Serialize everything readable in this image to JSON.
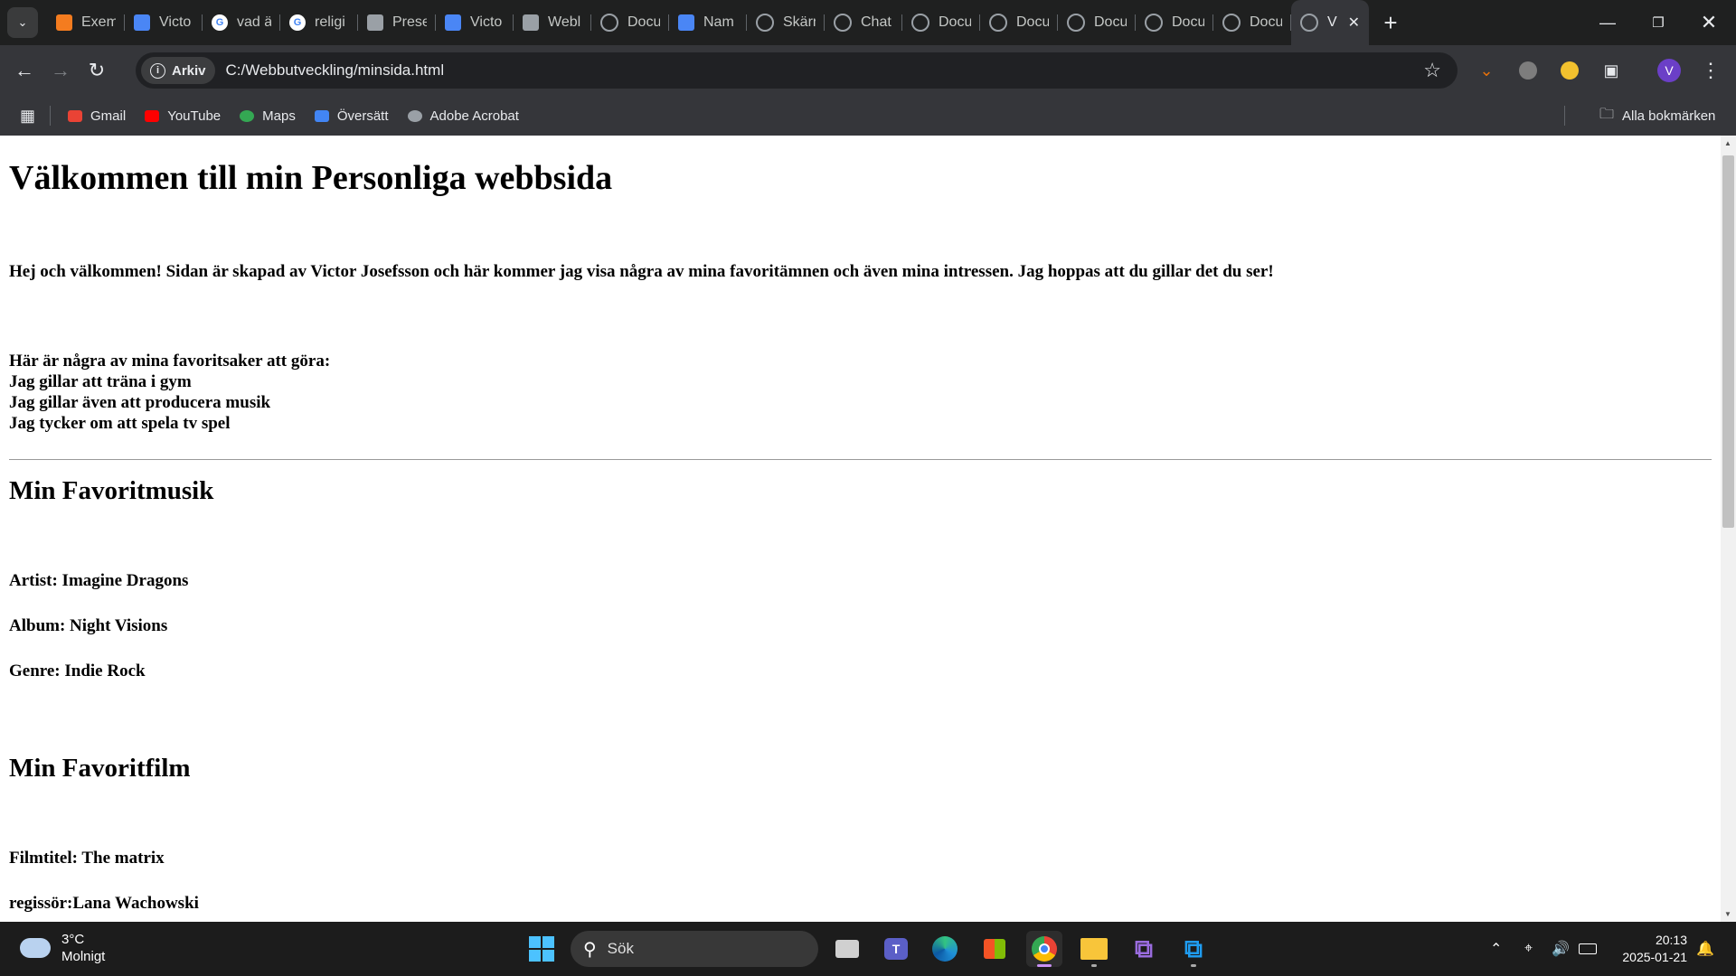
{
  "tabs": [
    {
      "title": "Exem",
      "icon": "presentation-icon",
      "color": "#f47c1f"
    },
    {
      "title": "Victo",
      "icon": "docs-icon",
      "color": "#4a86f5"
    },
    {
      "title": "vad ä",
      "icon": "google-icon",
      "color": "#ffffff"
    },
    {
      "title": "religi",
      "icon": "google-icon",
      "color": "#ffffff"
    },
    {
      "title": "Prese",
      "icon": "slides-icon",
      "color": "#9aa0a6"
    },
    {
      "title": "Victo",
      "icon": "docs-icon",
      "color": "#4a86f5"
    },
    {
      "title": "Webl",
      "icon": "slides-icon",
      "color": "#9aa0a6"
    },
    {
      "title": "Docu",
      "icon": "globe-icon",
      "color": "#9aa0a6"
    },
    {
      "title": "Nam",
      "icon": "docs-icon",
      "color": "#4a86f5"
    },
    {
      "title": "Skärn",
      "icon": "globe-icon",
      "color": "#9aa0a6"
    },
    {
      "title": "Chat",
      "icon": "chatgpt-icon",
      "color": "#9aa0a6"
    },
    {
      "title": "Docu",
      "icon": "globe-icon",
      "color": "#9aa0a6"
    },
    {
      "title": "Docu",
      "icon": "globe-icon",
      "color": "#9aa0a6"
    },
    {
      "title": "Docu",
      "icon": "globe-icon",
      "color": "#9aa0a6"
    },
    {
      "title": "Docu",
      "icon": "globe-icon",
      "color": "#9aa0a6"
    },
    {
      "title": "Docu",
      "icon": "globe-icon",
      "color": "#9aa0a6"
    },
    {
      "title": "V",
      "icon": "globe-icon",
      "color": "#9aa0a6",
      "active": true
    }
  ],
  "toolbar": {
    "site_chip": "Arkiv",
    "url": "C:/Webbutveckling/minsida.html",
    "profile_initial": "V"
  },
  "bookmarks": {
    "items": [
      {
        "label": "Gmail",
        "icon": "gmail-icon"
      },
      {
        "label": "YouTube",
        "icon": "youtube-icon"
      },
      {
        "label": "Maps",
        "icon": "maps-icon"
      },
      {
        "label": "Översätt",
        "icon": "translate-icon"
      },
      {
        "label": "Adobe Acrobat",
        "icon": "globe-icon"
      }
    ],
    "all_label": "Alla bokmärken"
  },
  "page": {
    "title": "Välkommen till min Personliga webbsida",
    "intro": "Hej och välkommen! Sidan är skapad av Victor Josefsson och här kommer jag visa några av mina favoritämnen och även mina intressen. Jag hoppas att du gillar det du ser!",
    "favorites_heading": "Här är några av mina favoritsaker att göra:",
    "favorites": [
      "Jag gillar att träna i gym",
      "Jag gillar även att producera musik",
      "Jag tycker om att spela tv spel"
    ],
    "music_heading": "Min Favoritmusik",
    "artist": "Artist: Imagine Dragons",
    "album": "Album: Night Visions",
    "genre": "Genre: Indie Rock",
    "film_heading": "Min Favoritfilm",
    "film_title": "Filmtitel: The matrix",
    "director": "regissör:Lana Wachowski"
  },
  "taskbar": {
    "temperature": "3°C",
    "condition": "Molnigt",
    "search_label": "Sök",
    "time": "20:13",
    "date": "2025-01-21"
  }
}
